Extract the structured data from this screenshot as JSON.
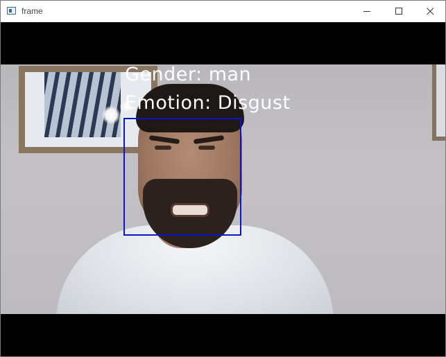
{
  "window": {
    "title": "frame",
    "app_icon": "window-app-icon",
    "controls": {
      "minimize_icon": "minimize-icon",
      "maximize_icon": "maximize-icon",
      "close_icon": "close-icon"
    }
  },
  "detection": {
    "gender_text": "Gender: man",
    "emotion_text": "Emotion: Disgust",
    "box_color": "#0a14c8",
    "text_color": "#ffffff"
  }
}
